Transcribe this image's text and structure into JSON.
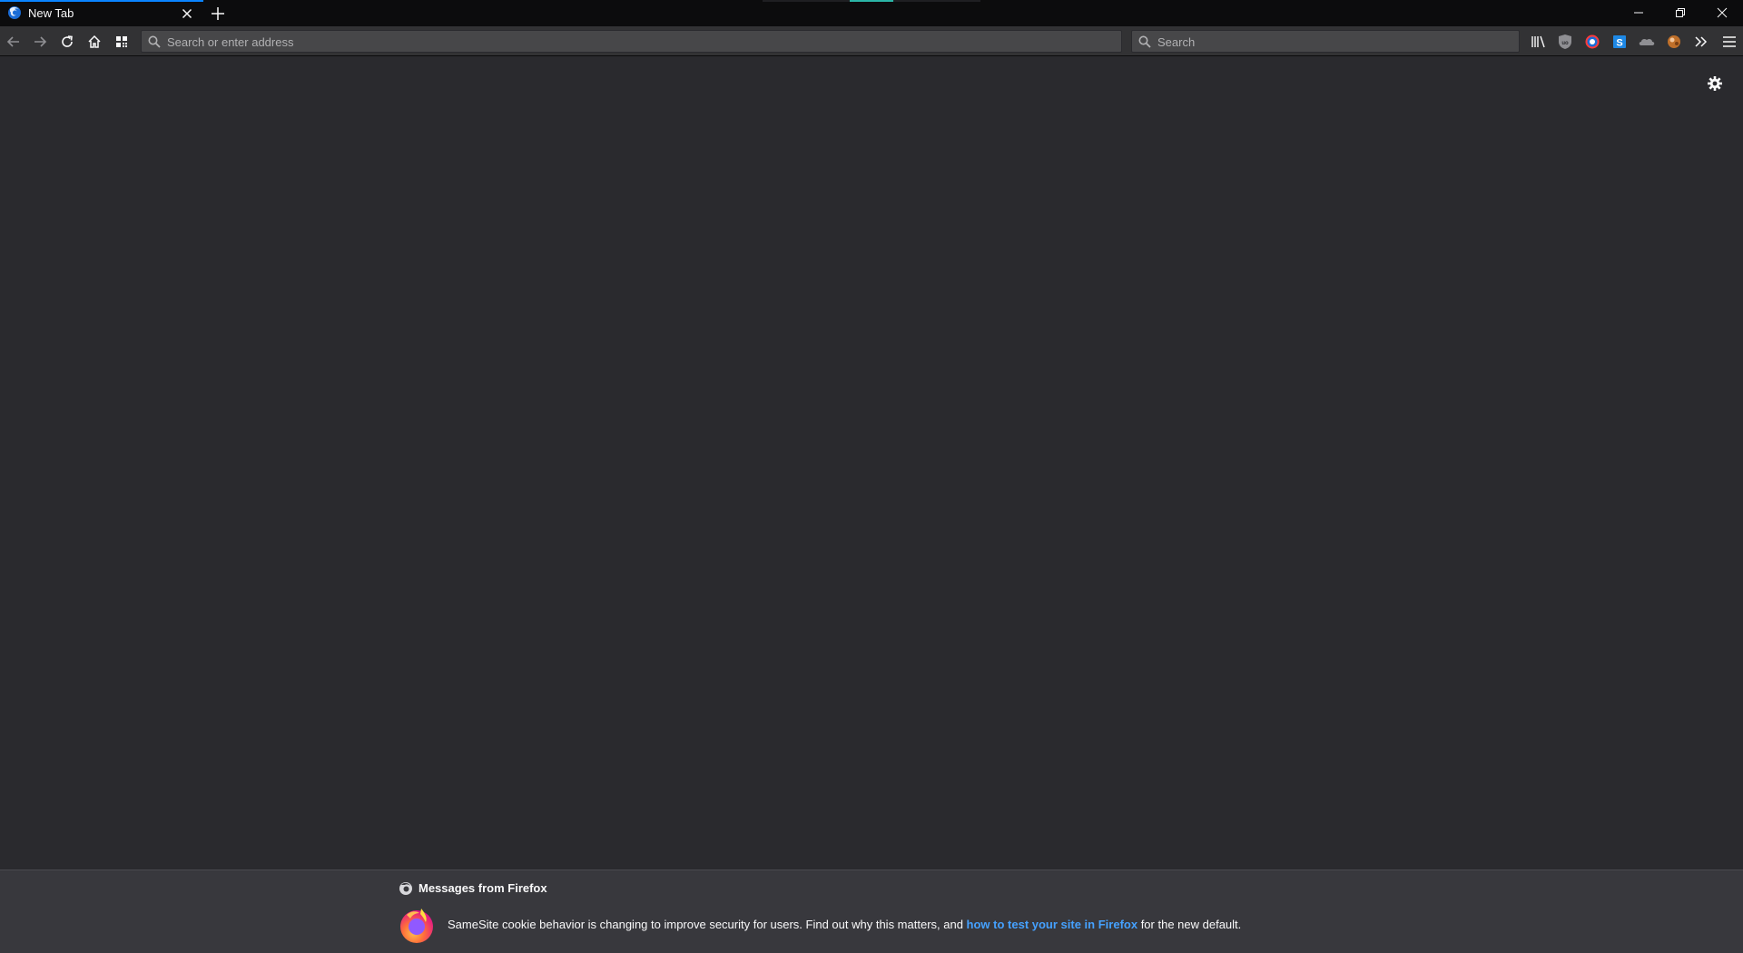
{
  "tabs": [
    {
      "title": "New Tab",
      "favicon": "firefox-icon",
      "active": true
    }
  ],
  "colors": {
    "accent": "#0a84ff",
    "link": "#45a1ff",
    "background": "#2a2a2e",
    "toolbar": "#323234"
  },
  "urlbar": {
    "placeholder": "Search or enter address",
    "value": ""
  },
  "searchbar": {
    "placeholder": "Search",
    "value": ""
  },
  "toolbar_icons": [
    "back-icon",
    "forward-icon",
    "reload-icon",
    "home-icon",
    "apps-grid-icon",
    "library-icon",
    "ublock-icon",
    "ghostery-icon",
    "s-extension-icon",
    "cloud-extension-icon",
    "avatar-extension-icon",
    "overflow-chevron-icon",
    "menu-icon"
  ],
  "snippet": {
    "header": "Messages from Firefox",
    "text_before": "SameSite cookie behavior is changing to improve security for users. Find out why this matters, and ",
    "link_text": "how to test your site in Firefox",
    "text_after": " for the new default."
  }
}
